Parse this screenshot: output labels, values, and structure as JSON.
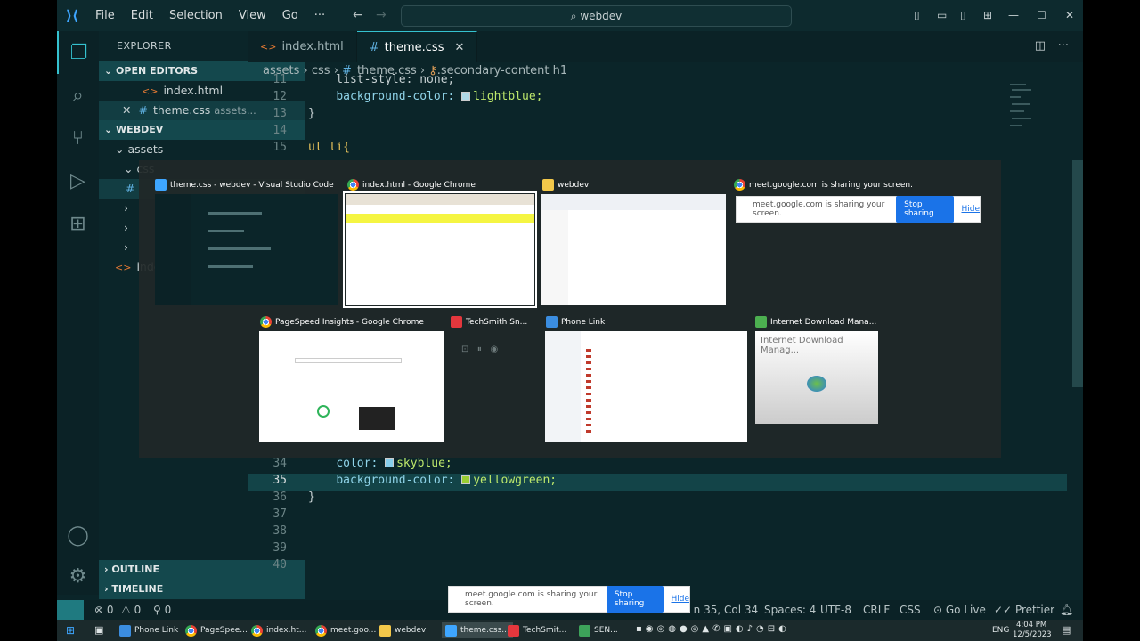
{
  "titlebar": {
    "menus": [
      "File",
      "Edit",
      "Selection",
      "View",
      "Go",
      "···"
    ],
    "search": "webdev",
    "window_controls": [
      "—",
      "☐",
      "✕"
    ]
  },
  "sidebar": {
    "header": "EXPLORER",
    "dots": "···",
    "open_editors_label": "OPEN EDITORS",
    "open_editors": [
      {
        "name": "index.html",
        "path": ""
      },
      {
        "name": "theme.css",
        "path": "assets..."
      }
    ],
    "workspace_label": "WEBDEV",
    "tree": [
      "assets",
      "css",
      "inde"
    ],
    "outline_label": "OUTLINE",
    "timeline_label": "TIMELINE"
  },
  "tabs": [
    {
      "label": "index.html",
      "active": false
    },
    {
      "label": "theme.css",
      "active": true
    }
  ],
  "breadcrumb": [
    "assets",
    "css",
    "theme.css",
    ".secondary-content h1"
  ],
  "editor": {
    "lines": [
      {
        "n": "11",
        "text": "    list-style: none;"
      },
      {
        "n": "12",
        "prop": "background-color:",
        "swatch": "#add8e6",
        "val": "lightblue;"
      },
      {
        "n": "13",
        "text": "}"
      },
      {
        "n": "14",
        "text": ""
      },
      {
        "n": "15",
        "sel": "ul li{"
      },
      {
        "n": "34",
        "prop": "color:",
        "swatch": "#87ceeb",
        "val": "skyblue;"
      },
      {
        "n": "35",
        "prop": "background-color:",
        "swatch": "#9acd32",
        "val": "yellowgreen;"
      },
      {
        "n": "36",
        "text": "}"
      },
      {
        "n": "37",
        "text": ""
      },
      {
        "n": "38",
        "text": ""
      },
      {
        "n": "39",
        "text": ""
      },
      {
        "n": "40",
        "text": ""
      }
    ],
    "current_line": "35"
  },
  "alttab": {
    "windows": [
      {
        "title": "theme.css - webdev - Visual Studio Code",
        "icon_color": "#3ea6ff",
        "selected": false
      },
      {
        "title": "index.html - Google Chrome",
        "icon_color": "chrome",
        "selected": true
      },
      {
        "title": "webdev",
        "icon_color": "#f3c84a",
        "selected": false
      },
      {
        "title": "meet.google.com is sharing your screen.",
        "icon_color": "chrome",
        "selected": false
      },
      {
        "title": "PageSpeed Insights - Google Chrome",
        "icon_color": "chrome",
        "selected": false
      },
      {
        "title": "TechSmith Sn...",
        "icon_color": "#e4373d",
        "selected": false
      },
      {
        "title": "Phone Link",
        "icon_color": "#3b8de0",
        "selected": false
      },
      {
        "title": "Internet Download Mana...",
        "icon_color": "#4caf50",
        "selected": false
      }
    ],
    "idm_text": "Internet Download Manag..."
  },
  "share": {
    "message": "meet.google.com is sharing your screen.",
    "stop": "Stop sharing",
    "hide": "Hide"
  },
  "statusbar": {
    "errors": "⊗ 0",
    "warnings": "⚠ 0",
    "ports": "⚲ 0",
    "position": "Ln 35, Col 34",
    "spaces": "Spaces: 4",
    "encoding": "UTF-8",
    "eol": "CRLF",
    "language": "CSS",
    "golive": "Go Live",
    "prettier": "Prettier"
  },
  "taskbar": {
    "apps": [
      "Phone Link",
      "PageSpee...",
      "index.ht...",
      "meet.goo...",
      "webdev",
      "theme.css...",
      "TechSmit...",
      "SEN..."
    ],
    "lang": "ENG",
    "time": "4:04 PM",
    "date": "12/5/2023"
  }
}
